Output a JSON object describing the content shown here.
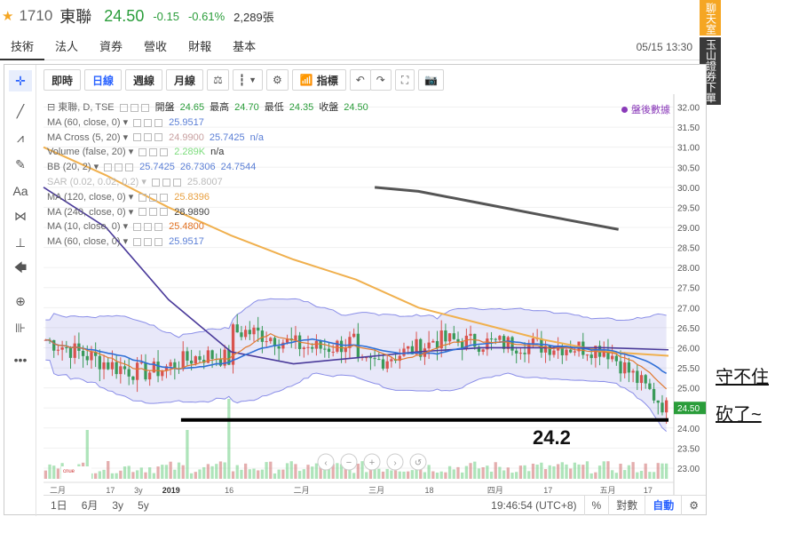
{
  "header": {
    "code": "1710",
    "name": "東聯",
    "price": "24.50",
    "change": "-0.15",
    "change_pct": "-0.61%",
    "volume": "2,289張"
  },
  "tabs": [
    "技術",
    "法人",
    "資券",
    "營收",
    "財報",
    "基本"
  ],
  "datetime": "05/15 13:30",
  "side_badges": [
    "聊天室",
    "玉山證券下單"
  ],
  "toolbar": {
    "intraday": "即時",
    "daily": "日線",
    "weekly": "週線",
    "monthly": "月線",
    "indicators": "指標"
  },
  "legend": [
    {
      "label": "東聯, D, TSE",
      "extra": [
        {
          "k": "開盤",
          "v": "24.65"
        },
        {
          "k": "最高",
          "v": "24.70"
        },
        {
          "k": "最低",
          "v": "24.35"
        },
        {
          "k": "收盤",
          "v": "24.50"
        }
      ]
    },
    {
      "label": "MA (60, close, 0)",
      "values": [
        "25.9517"
      ],
      "colors": [
        "#5b7fd6"
      ]
    },
    {
      "label": "MA Cross (5, 20)",
      "values": [
        "24.9900",
        "25.7425",
        "n/a"
      ],
      "colors": [
        "#c8a0a0",
        "#5b7fd6",
        "#5b7fd6"
      ]
    },
    {
      "label": "Volume (false, 20)",
      "values": [
        "2.289K",
        "n/a"
      ],
      "colors": [
        "#7ddc7d",
        "#333"
      ]
    },
    {
      "label": "BB (20, 2)",
      "values": [
        "25.7425",
        "26.7306",
        "24.7544"
      ],
      "colors": [
        "#5b7fd6",
        "#5b7fd6",
        "#5b7fd6"
      ]
    },
    {
      "label": "SAR (0.02, 0.02, 0.2)",
      "values": [
        "25.8007"
      ],
      "colors": [
        "#aaa"
      ],
      "dim": true
    },
    {
      "label": "MA (120, close, 0)",
      "values": [
        "25.8396"
      ],
      "colors": [
        "#e8a040"
      ]
    },
    {
      "label": "MA (240, close, 0)",
      "values": [
        "28.9890"
      ],
      "colors": [
        "#444"
      ]
    },
    {
      "label": "MA (10, close, 0)",
      "values": [
        "25.4800"
      ],
      "colors": [
        "#e07020"
      ]
    },
    {
      "label": "MA (60, close, 0)",
      "values": [
        "25.9517"
      ],
      "colors": [
        "#5b7fd6"
      ]
    }
  ],
  "post_market": "盤後數據",
  "price_axis": [
    "32.00",
    "31.50",
    "31.00",
    "30.50",
    "30.00",
    "29.50",
    "29.00",
    "28.50",
    "28.00",
    "27.50",
    "27.00",
    "26.50",
    "26.00",
    "25.50",
    "25.00",
    "24.50",
    "24.00",
    "23.50",
    "23.00"
  ],
  "last_price_tag": "24.50",
  "time_axis": [
    "二月",
    "17",
    "3y",
    "2019",
    "16",
    "二月",
    "三月",
    "18",
    "四月",
    "17",
    "五月",
    "17"
  ],
  "bottom": {
    "ranges": [
      "1日",
      "6月",
      "3y",
      "5y"
    ],
    "clock": "19:46:54 (UTC+8)",
    "pct": "%",
    "log": "對數",
    "auto": "自動"
  },
  "annotations": {
    "support_value": "24.2",
    "note_line1": "守不住",
    "note_line2": "砍了~"
  },
  "chart_data": {
    "type": "line",
    "ylim": [
      22.8,
      32.1
    ],
    "support_level": 24.2,
    "ma240": [
      [
        0.53,
        30.0
      ],
      [
        0.6,
        29.9
      ],
      [
        0.7,
        29.6
      ],
      [
        0.8,
        29.3
      ],
      [
        0.92,
        28.95
      ]
    ],
    "ma120": [
      [
        0.0,
        31.0
      ],
      [
        0.1,
        30.3
      ],
      [
        0.2,
        29.5
      ],
      [
        0.3,
        28.8
      ],
      [
        0.4,
        28.2
      ],
      [
        0.5,
        27.7
      ],
      [
        0.6,
        27.0
      ],
      [
        0.7,
        26.6
      ],
      [
        0.8,
        26.2
      ],
      [
        0.9,
        25.9
      ],
      [
        1.0,
        25.8
      ]
    ],
    "ma60": [
      [
        0.0,
        30.0
      ],
      [
        0.1,
        29.0
      ],
      [
        0.2,
        27.2
      ],
      [
        0.3,
        25.9
      ],
      [
        0.4,
        25.6
      ],
      [
        0.5,
        25.75
      ],
      [
        0.6,
        25.9
      ],
      [
        0.7,
        26.0
      ],
      [
        0.8,
        26.0
      ],
      [
        0.9,
        26.0
      ],
      [
        1.0,
        25.95
      ]
    ]
  }
}
